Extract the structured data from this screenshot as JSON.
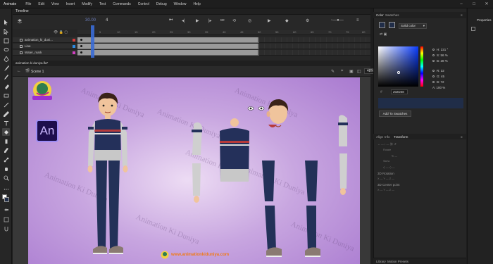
{
  "menubar": {
    "brand": "Animate",
    "items": [
      "File",
      "Edit",
      "View",
      "Insert",
      "Modify",
      "Text",
      "Commands",
      "Control",
      "Debug",
      "Window",
      "Help"
    ]
  },
  "timeline": {
    "tab_label": "Timeline",
    "fps": "30.00",
    "frame": "4",
    "ruler_ticks": [
      "5",
      "10",
      "15",
      "20",
      "25",
      "30",
      "35",
      "40",
      "45",
      "50",
      "55",
      "60",
      "65",
      "70",
      "75",
      "80"
    ],
    "layers": [
      {
        "name": "animation_ki_duni...",
        "color": "#d43a3a"
      },
      {
        "name": "Line",
        "color": "#2f8ae0"
      },
      {
        "name": "Water_mark",
        "color": "#d040c0"
      }
    ]
  },
  "document": {
    "tab_label": "animation ki duniya.fla*",
    "scene_label": "Scene 1",
    "zoom": "48%"
  },
  "stage": {
    "watermark": "Animation Ki Duniya",
    "footer_url": "www.animationkiduniya.com",
    "logo_text": "An",
    "background_top": "#eddcf4",
    "background_edge": "#a97ad0"
  },
  "color_panel": {
    "tabs": [
      "Color",
      "Swatches"
    ],
    "fill_type": "Solid color",
    "h": "H: 221 °",
    "s": "S: 56 %",
    "b": "B: 28 %",
    "r": "R: 32",
    "g": "G: 45",
    "bl": "B: 72",
    "a": "A: 100 %",
    "hex": "202D48",
    "current_color": "#202d48",
    "add_swatch_label": "Add To Swatches"
  },
  "transform_panel": {
    "tabs": [
      "Align",
      "Info",
      "Transform"
    ],
    "rotate_label": "Rotate",
    "skew_label": "Skew",
    "rotation_3d": "3D Rotation",
    "center_3d": "3D Center point"
  },
  "properties_panel": {
    "title": "Properties"
  },
  "library_tabs": [
    "Library",
    "Motion Presets"
  ]
}
